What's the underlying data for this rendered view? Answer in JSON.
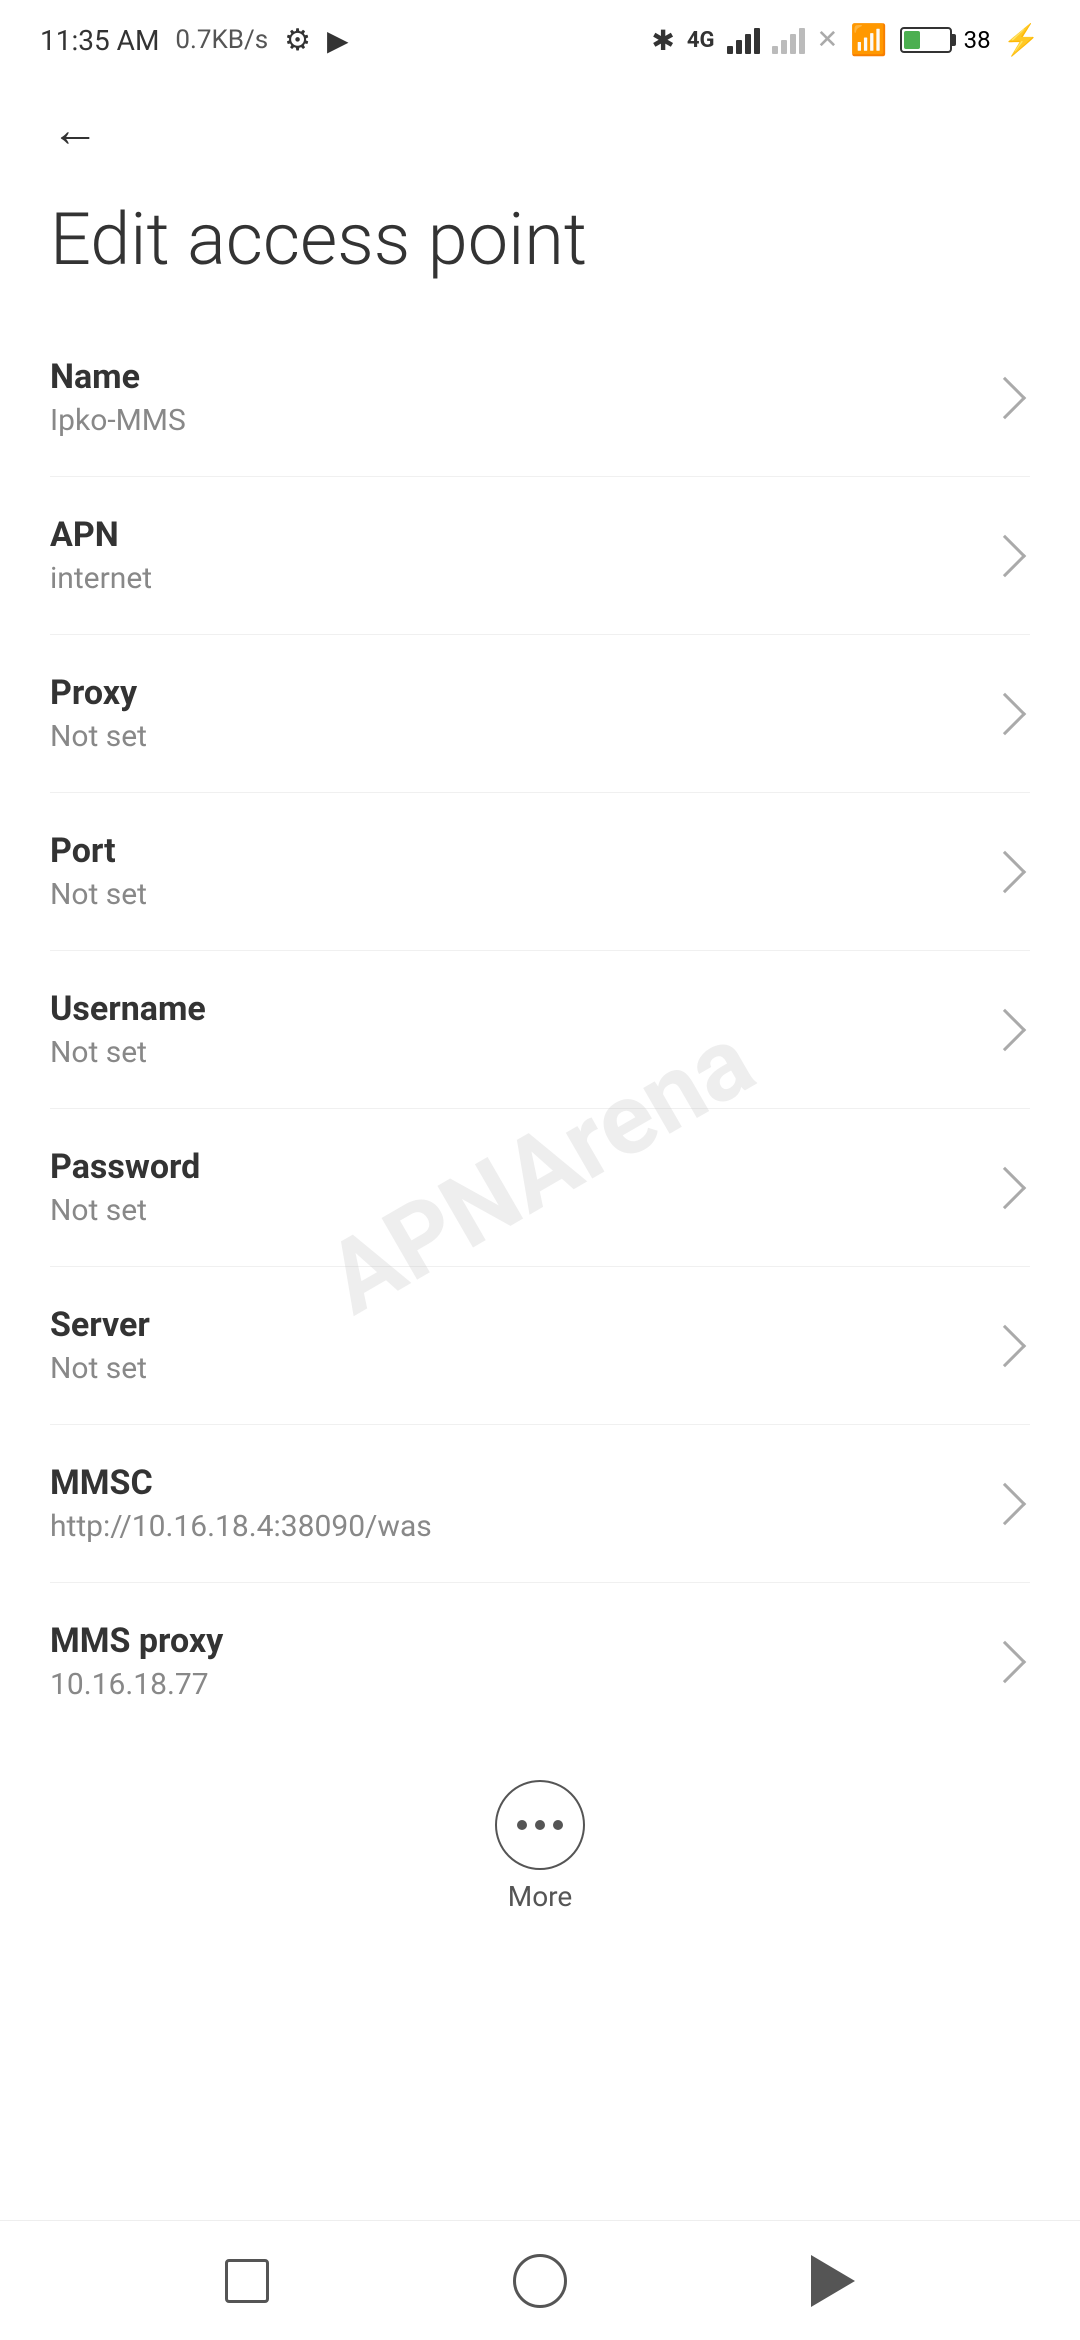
{
  "statusBar": {
    "time": "11:35 AM",
    "speed": "0.7KB/s",
    "batteryPercent": "38"
  },
  "navigation": {
    "backLabel": "←"
  },
  "page": {
    "title": "Edit access point"
  },
  "settings": [
    {
      "id": "name",
      "label": "Name",
      "value": "Ipko-MMS"
    },
    {
      "id": "apn",
      "label": "APN",
      "value": "internet"
    },
    {
      "id": "proxy",
      "label": "Proxy",
      "value": "Not set"
    },
    {
      "id": "port",
      "label": "Port",
      "value": "Not set"
    },
    {
      "id": "username",
      "label": "Username",
      "value": "Not set"
    },
    {
      "id": "password",
      "label": "Password",
      "value": "Not set"
    },
    {
      "id": "server",
      "label": "Server",
      "value": "Not set"
    },
    {
      "id": "mmsc",
      "label": "MMSC",
      "value": "http://10.16.18.4:38090/was"
    },
    {
      "id": "mms-proxy",
      "label": "MMS proxy",
      "value": "10.16.18.77"
    }
  ],
  "more": {
    "label": "More"
  },
  "watermark": "APNArena"
}
